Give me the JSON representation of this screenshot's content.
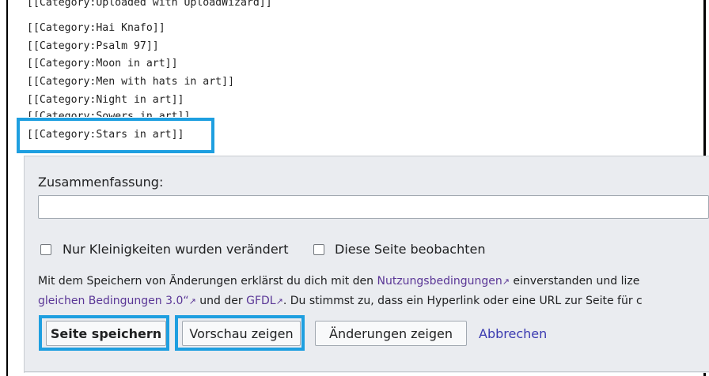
{
  "editor": {
    "lines": [
      "[[Category:Uploaded with UploadWizard]]",
      "[[Category:Hai Knafo]]",
      "[[Category:Psalm 97]]",
      "[[Category:Moon in art]]",
      "[[Category:Men with hats in art]]",
      "[[Category:Night in art]]",
      "[[Category:Sowers in art]]",
      "[[Category:Stars in art]]"
    ]
  },
  "summary": {
    "label": "Zusammenfassung:",
    "value": ""
  },
  "options": {
    "minor_label": "Nur Kleinigkeiten wurden verändert",
    "watch_label": "Diese Seite beobachten"
  },
  "legal": {
    "line1_prefix": "Mit dem Speichern von Änderungen erklärst du dich mit den ",
    "terms_link": "Nutzungsbedingungen",
    "line1_suffix": " einverstanden und lize",
    "line2_link1": "gleichen Bedingungen 3.0“",
    "line2_mid": " und der ",
    "gfdl_link": "GFDL",
    "line2_suffix": ". Du stimmst zu, dass ein Hyperlink oder eine URL zur Seite für c",
    "ext_icon": "external-link-icon"
  },
  "buttons": {
    "save": "Seite speichern",
    "preview": "Vorschau zeigen",
    "diff": "Änderungen zeigen",
    "cancel": "Abbrechen"
  },
  "colors": {
    "highlight": "#1e9fe0",
    "link": "#5a3696",
    "panel": "#eaecf0"
  }
}
